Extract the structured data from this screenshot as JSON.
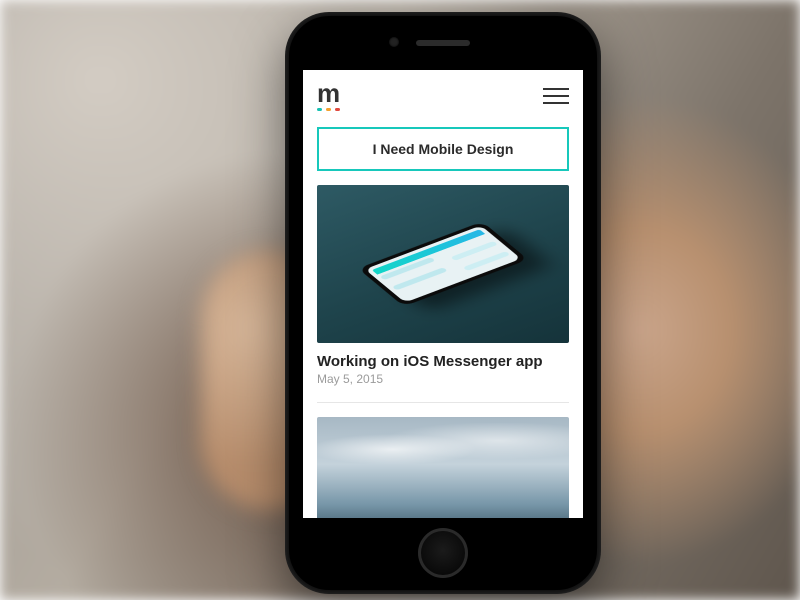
{
  "logo": {
    "letter": "m"
  },
  "cta": {
    "label": "I Need Mobile Design"
  },
  "posts": [
    {
      "title": "Working on iOS Messenger app",
      "date": "May 5, 2015"
    }
  ],
  "colors": {
    "accent": "#17c8bb"
  }
}
